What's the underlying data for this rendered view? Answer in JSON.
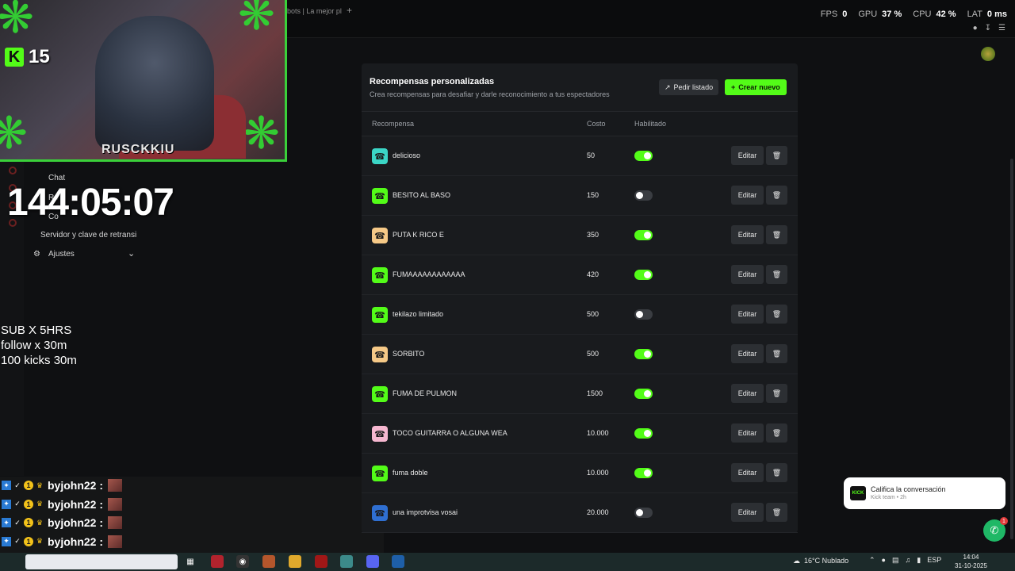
{
  "topbar": {
    "tab_title": "bots | La mejor pl",
    "tab_add": "+",
    "stats": [
      {
        "label": "FPS",
        "value": "0"
      },
      {
        "label": "GPU",
        "value": "37 %"
      },
      {
        "label": "CPU",
        "value": "42 %"
      },
      {
        "label": "LAT",
        "value": "0 ms"
      }
    ]
  },
  "overlay": {
    "kick_logo": "K",
    "kick_count": "15",
    "cam_caption": "RUSCKKIU",
    "timer": "144:05:07",
    "promo_lines": [
      "SUB X 5HRS",
      "follow x 30m",
      "100 kicks 30m"
    ]
  },
  "sidebar": {
    "chat": "Chat",
    "roles": "Ro",
    "content": "Co",
    "stream_key": "Servidor y clave de retransi",
    "settings": "Ajustes"
  },
  "chat": {
    "username": "byjohn22 :",
    "badge_count": "1",
    "lines": 5
  },
  "panel": {
    "title": "Recompensas personalizadas",
    "subtitle": "Crea recompensas para desafiar y darle reconocimiento a tus espectadores",
    "btn_list": "Pedir listado",
    "btn_new": "Crear nuevo",
    "col_reward": "Recompensa",
    "col_cost": "Costo",
    "col_enabled": "Habilitado",
    "edit_label": "Editar",
    "rows": [
      {
        "name": "delicioso",
        "cost": "50",
        "enabled": true,
        "color": "#3bd6c6"
      },
      {
        "name": "BESITO AL BASO",
        "cost": "150",
        "enabled": false,
        "color": "#53fc18"
      },
      {
        "name": "PUTA K RICO E",
        "cost": "350",
        "enabled": true,
        "color": "#f6c987"
      },
      {
        "name": "FUMAAAAAAAAAAAA",
        "cost": "420",
        "enabled": true,
        "color": "#53fc18"
      },
      {
        "name": "tekilazo limitado",
        "cost": "500",
        "enabled": false,
        "color": "#53fc18"
      },
      {
        "name": "SORBITO",
        "cost": "500",
        "enabled": true,
        "color": "#f6c987"
      },
      {
        "name": "FUMA DE PULMON",
        "cost": "1500",
        "enabled": true,
        "color": "#53fc18"
      },
      {
        "name": "TOCO GUITARRA O ALGUNA WEA",
        "cost": "10.000",
        "enabled": true,
        "color": "#f6b7d0"
      },
      {
        "name": "fuma doble",
        "cost": "10.000",
        "enabled": true,
        "color": "#53fc18"
      },
      {
        "name": "una improtvisa vosai",
        "cost": "20.000",
        "enabled": false,
        "color": "#2f6fd1"
      }
    ]
  },
  "toast": {
    "logo": "KICK",
    "title": "Califica la conversación",
    "subtitle": "Kick team • 2h",
    "badge": "1"
  },
  "taskbar": {
    "weather": "16°C  Nublado",
    "lang": "ESP",
    "time": "14:04",
    "date": "31-10-2025"
  }
}
